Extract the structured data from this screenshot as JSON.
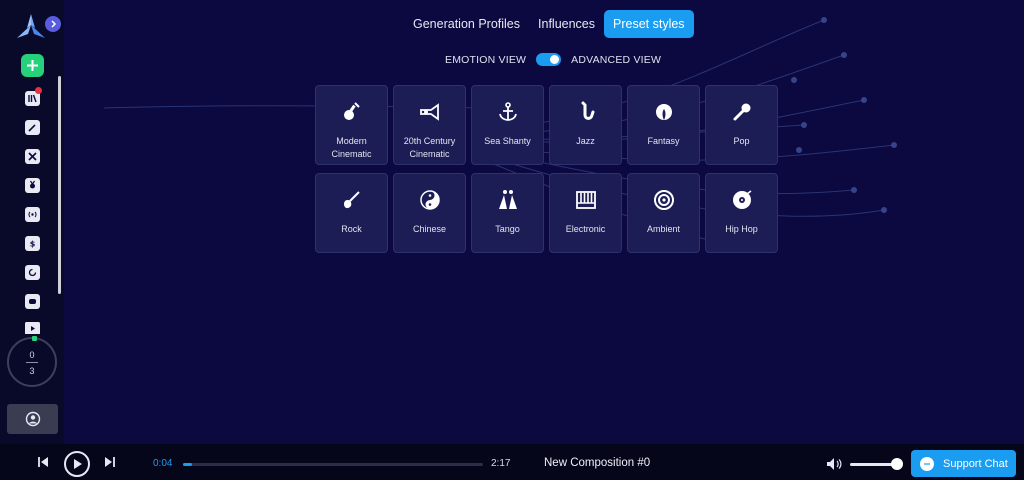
{
  "tabs": [
    {
      "label": "Generation Profiles",
      "active": false
    },
    {
      "label": "Influences",
      "active": false
    },
    {
      "label": "Preset styles",
      "active": true
    }
  ],
  "view_toggle": {
    "left_label": "EMOTION VIEW",
    "right_label": "ADVANCED VIEW",
    "state": "advanced"
  },
  "styles": [
    {
      "label": "Modern Cinematic",
      "icon": "violin-icon"
    },
    {
      "label": "20th Century Cinematic",
      "icon": "horn-icon"
    },
    {
      "label": "Sea Shanty",
      "icon": "anchor-icon"
    },
    {
      "label": "Jazz",
      "icon": "saxophone-icon"
    },
    {
      "label": "Fantasy",
      "icon": "dragon-icon"
    },
    {
      "label": "Pop",
      "icon": "microphone-icon"
    },
    {
      "label": "Rock",
      "icon": "guitar-icon"
    },
    {
      "label": "Chinese",
      "icon": "yin-yang-icon"
    },
    {
      "label": "Tango",
      "icon": "dancers-icon"
    },
    {
      "label": "Electronic",
      "icon": "keyboard-icon"
    },
    {
      "label": "Ambient",
      "icon": "speaker-icon"
    },
    {
      "label": "Hip Hop",
      "icon": "record-icon"
    }
  ],
  "counter": {
    "used": "0",
    "total": "3"
  },
  "player": {
    "current_time": "0:04",
    "duration": "2:17",
    "progress": 0.03,
    "title": "New Composition #0",
    "volume": 0.9
  },
  "support": {
    "label": "Support Chat"
  },
  "colors": {
    "accent": "#1a9cf0",
    "add": "#27d07a",
    "background": "#0c0840",
    "card": "#1c1d55"
  }
}
